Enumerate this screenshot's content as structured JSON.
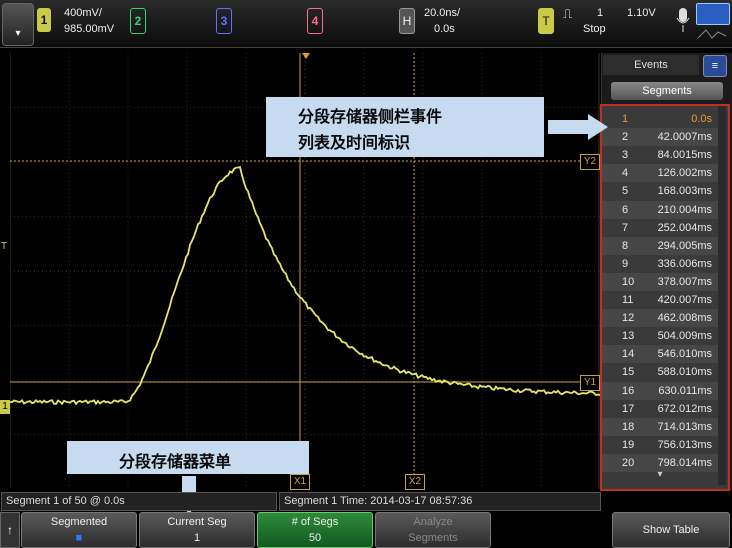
{
  "topbar": {
    "menu_label": "",
    "ch1": {
      "num": "1",
      "scale": "400mV/",
      "offset": "985.00mV",
      "color": "#e3e36a"
    },
    "ch2": {
      "num": "2",
      "color": "#38d070"
    },
    "ch3": {
      "num": "3",
      "color": "#6070ff"
    },
    "ch4": {
      "num": "4",
      "color": "#ff6a8a"
    },
    "h": {
      "label": "H",
      "scale": "20.0ns/",
      "delay": "0.0s"
    },
    "trig": {
      "label": "T",
      "symbol": "⎍",
      "source": "1",
      "level": "1.10V",
      "mode": "Stop"
    }
  },
  "markers": {
    "y1": "Y1",
    "y2": "Y2",
    "x1": "X1",
    "x2": "X2",
    "trigger_t": "T",
    "ch1_ground": "1"
  },
  "sidebar": {
    "title": "Events",
    "segments_button": "Segments",
    "events": [
      {
        "n": "1",
        "t": "0.0s"
      },
      {
        "n": "2",
        "t": "42.0007ms"
      },
      {
        "n": "3",
        "t": "84.0015ms"
      },
      {
        "n": "4",
        "t": "126.002ms"
      },
      {
        "n": "5",
        "t": "168.003ms"
      },
      {
        "n": "6",
        "t": "210.004ms"
      },
      {
        "n": "7",
        "t": "252.004ms"
      },
      {
        "n": "8",
        "t": "294.005ms"
      },
      {
        "n": "9",
        "t": "336.006ms"
      },
      {
        "n": "10",
        "t": "378.007ms"
      },
      {
        "n": "11",
        "t": "420.007ms"
      },
      {
        "n": "12",
        "t": "462.008ms"
      },
      {
        "n": "13",
        "t": "504.009ms"
      },
      {
        "n": "14",
        "t": "546.010ms"
      },
      {
        "n": "15",
        "t": "588.010ms"
      },
      {
        "n": "16",
        "t": "630.011ms"
      },
      {
        "n": "17",
        "t": "672.012ms"
      },
      {
        "n": "18",
        "t": "714.013ms"
      },
      {
        "n": "19",
        "t": "756.013ms"
      },
      {
        "n": "20",
        "t": "798.014ms"
      }
    ]
  },
  "callouts": {
    "sidebar_note": "分段存储器侧栏事件列表及时间标识",
    "sidebar_note_line1": "分段存储器侧栏事件",
    "sidebar_note_line2": "列表及时间标识",
    "menu_note": "分段存储器菜单"
  },
  "status": {
    "left": "Segment 1 of 50 @ 0.0s",
    "right": "Segment 1 Time: 2014-03-17 08:57:36"
  },
  "softkeys": {
    "segmented": {
      "line1": "Segmented",
      "line2": "■"
    },
    "current_seg": {
      "line1": "Current Seg",
      "line2": "1"
    },
    "num_segs": {
      "line1": "# of Segs",
      "line2": "50"
    },
    "analyze": {
      "line1": "Analyze",
      "line2": "Segments"
    },
    "show_table": "Show Table"
  }
}
